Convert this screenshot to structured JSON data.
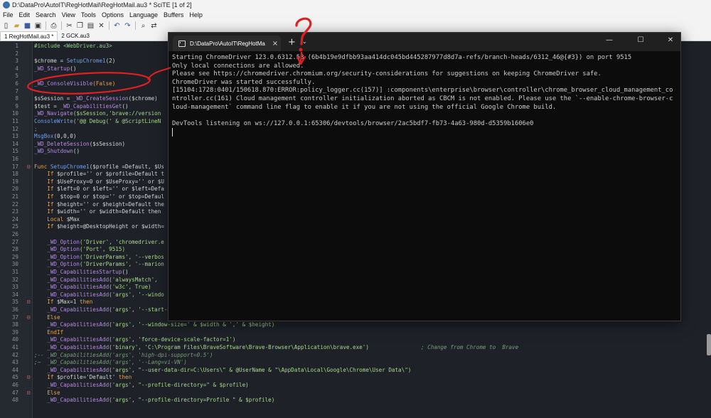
{
  "window": {
    "title": "D:\\DataPro\\AutoIT\\RegHotMail\\RegHotMail.au3 * SciTE [1 of 2]"
  },
  "menu": [
    "File",
    "Edit",
    "Search",
    "View",
    "Tools",
    "Options",
    "Language",
    "Buffers",
    "Help"
  ],
  "toolbar_icons": [
    "new-file-icon",
    "open-file-icon",
    "save-icon",
    "save-all-icon",
    "print-icon",
    "cut-icon",
    "copy-icon",
    "paste-icon",
    "delete-icon",
    "undo-icon",
    "redo-icon",
    "find-icon",
    "replace-icon"
  ],
  "tabs": [
    {
      "label": "1 RegHotMail.au3 *",
      "active": true
    },
    {
      "label": "2 GCK.au3",
      "active": false
    }
  ],
  "editor": {
    "lines": [
      {
        "n": "1",
        "fold": "",
        "segs": [
          [
            "#include <WebDriver.au3>",
            "c-green"
          ]
        ]
      },
      {
        "n": "2",
        "fold": "",
        "segs": []
      },
      {
        "n": "3",
        "fold": "",
        "segs": [
          [
            "$chrome",
            "c-white"
          ],
          [
            " = ",
            "c-white"
          ],
          [
            "SetupChrome1",
            "c-blue"
          ],
          [
            "(2)",
            "c-white"
          ]
        ]
      },
      {
        "n": "4",
        "fold": "",
        "segs": [
          [
            "_WD_Startup",
            "c-purple"
          ],
          [
            "()",
            "c-white"
          ]
        ]
      },
      {
        "n": "5",
        "fold": "",
        "segs": []
      },
      {
        "n": "6",
        "fold": "",
        "segs": [
          [
            "_WD_ConsoleVisible",
            "c-purple"
          ],
          [
            "(False)",
            "c-orange"
          ]
        ]
      },
      {
        "n": "7",
        "fold": "",
        "segs": []
      },
      {
        "n": "8",
        "fold": "",
        "segs": [
          [
            "$sSession",
            "c-white"
          ],
          [
            " = ",
            "c-white"
          ],
          [
            "_WD_CreateSession",
            "c-purple"
          ],
          [
            "($chrome)",
            "c-white"
          ]
        ]
      },
      {
        "n": "9",
        "fold": "",
        "segs": [
          [
            "$test",
            "c-white"
          ],
          [
            " = ",
            "c-white"
          ],
          [
            "_WD_CapabilitiesGet",
            "c-purple"
          ],
          [
            "()",
            "c-white"
          ]
        ]
      },
      {
        "n": "10",
        "fold": "",
        "segs": [
          [
            "_WD_Navigate",
            "c-purple"
          ],
          [
            "($sSession,'brave://version",
            "c-lgreen"
          ]
        ]
      },
      {
        "n": "11",
        "fold": "",
        "segs": [
          [
            "ConsoleWrite",
            "c-blue"
          ],
          [
            "('@@ Debug(' & @ScriptLineN",
            "c-lgreen"
          ]
        ]
      },
      {
        "n": "12",
        "fold": "",
        "segs": [
          [
            ";",
            "c-gray"
          ]
        ]
      },
      {
        "n": "13",
        "fold": "",
        "segs": [
          [
            "MsgBox",
            "c-blue"
          ],
          [
            "(0,0,0)",
            "c-white"
          ]
        ]
      },
      {
        "n": "14",
        "fold": "",
        "segs": [
          [
            "_WD_DeleteSession",
            "c-purple"
          ],
          [
            "($sSession)",
            "c-white"
          ]
        ]
      },
      {
        "n": "15",
        "fold": "",
        "segs": [
          [
            "_WD_Shutdown",
            "c-purple"
          ],
          [
            "()",
            "c-white"
          ]
        ]
      },
      {
        "n": "16",
        "fold": "",
        "segs": []
      },
      {
        "n": "17",
        "fold": "⊟",
        "segs": [
          [
            "Func ",
            "c-orange"
          ],
          [
            "SetupChrome1",
            "c-blue"
          ],
          [
            "($profile =Default, $Us",
            "c-white"
          ]
        ]
      },
      {
        "n": "18",
        "fold": "",
        "segs": [
          [
            "    If ",
            "c-orange"
          ],
          [
            "$profile='' or $profile=Default t",
            "c-white"
          ]
        ]
      },
      {
        "n": "19",
        "fold": "",
        "segs": [
          [
            "    If ",
            "c-orange"
          ],
          [
            "$UseProxy=0 or $UseProxy='' or $U",
            "c-white"
          ]
        ]
      },
      {
        "n": "20",
        "fold": "",
        "segs": [
          [
            "    If ",
            "c-orange"
          ],
          [
            "$left=0 or $left='' or $left=Defa",
            "c-white"
          ]
        ]
      },
      {
        "n": "21",
        "fold": "",
        "segs": [
          [
            "    If ",
            "c-orange"
          ],
          [
            " $top=0 or $top='' or $top=Defaul",
            "c-white"
          ]
        ]
      },
      {
        "n": "22",
        "fold": "",
        "segs": [
          [
            "    If ",
            "c-orange"
          ],
          [
            "$height='' or $height=Default the",
            "c-white"
          ]
        ]
      },
      {
        "n": "23",
        "fold": "",
        "segs": [
          [
            "    If ",
            "c-orange"
          ],
          [
            "$width='' or $width=Default then",
            "c-white"
          ]
        ]
      },
      {
        "n": "24",
        "fold": "",
        "segs": [
          [
            "    Local ",
            "c-orange"
          ],
          [
            "$Max",
            "c-white"
          ]
        ]
      },
      {
        "n": "25",
        "fold": "",
        "segs": [
          [
            "    If ",
            "c-orange"
          ],
          [
            "$height=@DesktopHeight or $width=",
            "c-white"
          ]
        ]
      },
      {
        "n": "26",
        "fold": "",
        "segs": []
      },
      {
        "n": "27",
        "fold": "",
        "segs": [
          [
            "    _WD_Option",
            "c-purple"
          ],
          [
            "('Driver', 'chromedriver.e",
            "c-lgreen"
          ]
        ]
      },
      {
        "n": "28",
        "fold": "",
        "segs": [
          [
            "    _WD_Option",
            "c-purple"
          ],
          [
            "('Port', 9515)",
            "c-lgreen"
          ]
        ]
      },
      {
        "n": "29",
        "fold": "",
        "segs": [
          [
            "    _WD_Option",
            "c-purple"
          ],
          [
            "('DriverParams', '--verbos",
            "c-lgreen"
          ]
        ]
      },
      {
        "n": "30",
        "fold": "",
        "segs": [
          [
            "    _WD_Option",
            "c-purple"
          ],
          [
            "('DriverParams', '--marion",
            "c-lgreen"
          ]
        ]
      },
      {
        "n": "31",
        "fold": "",
        "segs": [
          [
            "    _WD_CapabilitiesStartup",
            "c-purple"
          ],
          [
            "()",
            "c-white"
          ]
        ]
      },
      {
        "n": "32",
        "fold": "",
        "segs": [
          [
            "    _WD_CapabilitiesAdd",
            "c-purple"
          ],
          [
            "('alwaysMatch', ",
            "c-lgreen"
          ]
        ]
      },
      {
        "n": "33",
        "fold": "",
        "segs": [
          [
            "    _WD_CapabilitiesAdd",
            "c-purple"
          ],
          [
            "('w3c', True)",
            "c-lgreen"
          ]
        ]
      },
      {
        "n": "34",
        "fold": "",
        "segs": [
          [
            "    _WD_CapabilitiesAdd",
            "c-purple"
          ],
          [
            "('args', '--windo",
            "c-lgreen"
          ]
        ]
      },
      {
        "n": "35",
        "fold": "⊟",
        "segs": [
          [
            "    If ",
            "c-orange"
          ],
          [
            "$Max=1 ",
            "c-white"
          ],
          [
            "then",
            "c-orange"
          ]
        ]
      },
      {
        "n": "36",
        "fold": "",
        "segs": [
          [
            "    _WD_CapabilitiesAdd",
            "c-purple"
          ],
          [
            "('args', '--start-maximized')",
            "c-lgreen"
          ]
        ]
      },
      {
        "n": "37",
        "fold": "⊟",
        "segs": [
          [
            "    Else",
            "c-orange"
          ]
        ]
      },
      {
        "n": "38",
        "fold": "",
        "segs": [
          [
            "    _WD_CapabilitiesAdd",
            "c-purple"
          ],
          [
            "('args', '--window-size=' & $width & ',' & $height)",
            "c-lgreen"
          ]
        ]
      },
      {
        "n": "39",
        "fold": "",
        "segs": [
          [
            "    EndIf",
            "c-orange"
          ]
        ]
      },
      {
        "n": "40",
        "fold": "",
        "segs": [
          [
            "    _WD_CapabilitiesAdd",
            "c-purple"
          ],
          [
            "('args', 'force-device-scale-factor=1')",
            "c-lgreen"
          ]
        ]
      },
      {
        "n": "41",
        "fold": "",
        "segs": [
          [
            "    _WD_CapabilitiesAdd",
            "c-purple"
          ],
          [
            "('binary', 'C:\\Program Files\\BraveSoftware\\Brave-Browser\\Application\\brave.exe')",
            "c-lgreen"
          ],
          [
            "                ; Change from Chrome to  Brave",
            "c-comment"
          ]
        ]
      },
      {
        "n": "42",
        "fold": "",
        "segs": [
          [
            ";-- _WD_CapabilitiesAdd('args', 'high-dpi-support=0.5')",
            "c-comment"
          ]
        ]
      },
      {
        "n": "43",
        "fold": "",
        "segs": [
          [
            ";~  _WD_CapabilitiesAdd('args', '--Lang=vi-VN')",
            "c-comment"
          ]
        ]
      },
      {
        "n": "44",
        "fold": "",
        "segs": [
          [
            "    _WD_CapabilitiesAdd",
            "c-purple"
          ],
          [
            "('args', \"--user-data-dir=C:\\Users\\\" & @UserName & \"\\AppData\\Local\\Google\\Chrome\\User Data\\\")",
            "c-lgreen"
          ]
        ]
      },
      {
        "n": "45",
        "fold": "⊟",
        "segs": [
          [
            "    If ",
            "c-orange"
          ],
          [
            "$profile='Default' ",
            "c-white"
          ],
          [
            "then",
            "c-orange"
          ]
        ]
      },
      {
        "n": "46",
        "fold": "",
        "segs": [
          [
            "    _WD_CapabilitiesAdd",
            "c-purple"
          ],
          [
            "('args', \"--profile-directory=\" & $profile)",
            "c-lgreen"
          ]
        ]
      },
      {
        "n": "47",
        "fold": "⊟",
        "segs": [
          [
            "    Else",
            "c-orange"
          ]
        ]
      },
      {
        "n": "48",
        "fold": "",
        "segs": [
          [
            "    _WD_CapabilitiesAdd",
            "c-purple"
          ],
          [
            "('args', \"--profile-directory=Profile \" & $profile)",
            "c-lgreen"
          ]
        ]
      }
    ]
  },
  "terminal": {
    "tab_title": "D:\\DataPro\\AutoIT\\RegHotMa",
    "close_icon": "×",
    "new_tab_icon": "+",
    "dropdown_icon": "⌄",
    "minimize_icon": "—",
    "maximize_icon": "☐",
    "window_close_icon": "✕",
    "lines": [
      "Starting ChromeDriver 123.0.6312.58 (6b4b19e9dfbb93aa414dc045bd445287977d8d7a-refs/branch-heads/6312_46@{#3}) on port 9515",
      "Only local connections are allowed.",
      "Please see https://chromedriver.chromium.org/security-considerations for suggestions on keeping ChromeDriver safe.",
      "ChromeDriver was started successfully.",
      "[15104:1728:0401/150618.870:ERROR:policy_logger.cc(157)] :components\\enterprise\\browser\\controller\\chrome_browser_cloud_management_controller.cc(161) Cloud management controller initialization aborted as CBCM is not enabled. Please use the `--enable-chrome-browser-cloud-management` command line flag to enable it if you are not using the official Google Chrome build.",
      "",
      "DevTools listening on ws://127.0.0.1:65306/devtools/browser/2ac5bdf7-fb73-4a63-980d-d5359b1606e0"
    ]
  },
  "annotations": {
    "question_mark": "?"
  }
}
